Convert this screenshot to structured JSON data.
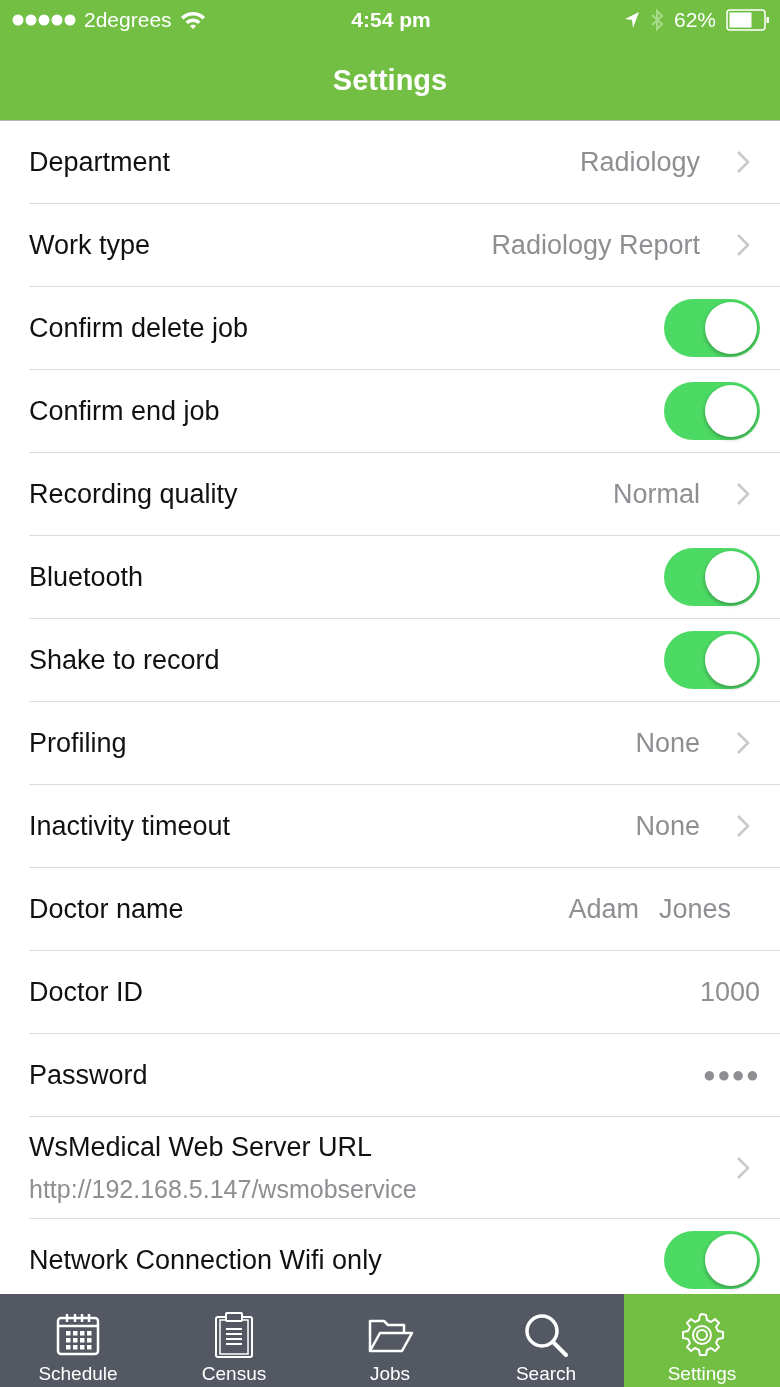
{
  "status_bar": {
    "carrier": "2degrees",
    "time": "4:54 pm",
    "battery": "62%"
  },
  "nav_bar": {
    "title": "Settings"
  },
  "settings": [
    {
      "kind": "disclosure",
      "label": "Department",
      "value": "Radiology"
    },
    {
      "kind": "disclosure",
      "label": "Work type",
      "value": "Radiology Report"
    },
    {
      "kind": "toggle",
      "label": "Confirm delete job",
      "on": true
    },
    {
      "kind": "toggle",
      "label": "Confirm end job",
      "on": true
    },
    {
      "kind": "disclosure",
      "label": "Recording quality",
      "value": "Normal"
    },
    {
      "kind": "toggle",
      "label": "Bluetooth",
      "on": true
    },
    {
      "kind": "toggle",
      "label": "Shake to record",
      "on": true
    },
    {
      "kind": "disclosure",
      "label": "Profiling",
      "value": "None"
    },
    {
      "kind": "disclosure",
      "label": "Inactivity timeout",
      "value": "None"
    },
    {
      "kind": "name",
      "label": "Doctor name",
      "first_name": "Adam",
      "last_name": "Jones"
    },
    {
      "kind": "field",
      "label": "Doctor ID",
      "value": "1000"
    },
    {
      "kind": "password",
      "label": "Password",
      "value": "●●●●"
    },
    {
      "kind": "url",
      "label": "WsMedical Web Server URL",
      "value": "http://192.168.5.147/wsmobservice"
    },
    {
      "kind": "toggle",
      "label": "Network Connection Wifi only",
      "on": true
    }
  ],
  "tab_bar": [
    {
      "label": "Schedule",
      "selected": false
    },
    {
      "label": "Census",
      "selected": false
    },
    {
      "label": "Jobs",
      "selected": false
    },
    {
      "label": "Search",
      "selected": false
    },
    {
      "label": "Settings",
      "selected": true
    }
  ]
}
